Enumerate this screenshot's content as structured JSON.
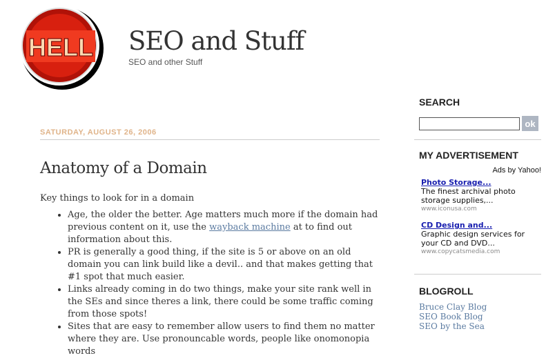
{
  "header": {
    "title": "SEO and Stuff",
    "description": "SEO and other Stuff",
    "logo_text": "HELL"
  },
  "post": {
    "date": "SATURDAY, AUGUST 26, 2006",
    "title": "Anatomy of a Domain",
    "intro": "Key things to look for in a domain",
    "points": [
      {
        "before": "Age, the older the better. Age matters much more if the domain had previous content on it, use the ",
        "link": "wayback machine",
        "after": " at to find out information about this."
      },
      {
        "text": "PR is generally a good thing, if the site is 5 or above on an old domain you can link build like a devil.. and that makes getting that #1 spot that much easier."
      },
      {
        "text": "Links already coming in do two things, make your site rank well in the SEs and since theres a link, there could be some traffic coming from those spots!"
      },
      {
        "text": "Sites that are easy to remember allow users to find them no matter where they are. Use pronouncable words, people like onomonopia words"
      }
    ]
  },
  "sidebar": {
    "search_heading": "SEARCH",
    "search_value": "",
    "ok_label": "ok",
    "ads_heading": "MY ADVERTISEMENT",
    "ads_by": "Ads by Yahoo!",
    "ads": [
      {
        "title": "Photo Storage...",
        "desc": "The finest archival photo storage supplies,...",
        "url": "www.iconusa.com"
      },
      {
        "title": "CD Design and...",
        "desc": "Graphic design services for your CD and DVD...",
        "url": "www.copycatsmedia.com"
      }
    ],
    "blogroll_heading": "BLOGROLL",
    "blogroll": [
      "Bruce Clay Blog",
      "SEO Book Blog",
      "SEO by the Sea"
    ]
  },
  "colors": {
    "date": "#e0b48a",
    "link": "#5a7aa0",
    "ad_link": "#1a20b0",
    "logo_red": "#e8281a"
  }
}
